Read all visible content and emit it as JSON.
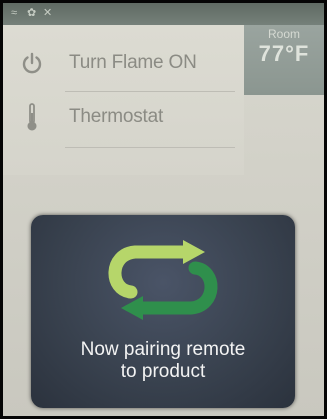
{
  "status_bar": {
    "icons": [
      "wifi-icon",
      "bluetooth-icon",
      "close-icon"
    ]
  },
  "menu": {
    "items": [
      {
        "label": "Turn Flame ON",
        "icon": "power-icon"
      },
      {
        "label": "Thermostat",
        "icon": "thermometer-icon"
      }
    ]
  },
  "room": {
    "label": "Room",
    "temperature": "77°F"
  },
  "overlay": {
    "message_line1": "Now pairing remote",
    "message_line2": "to product",
    "icon": "sync-arrows-icon",
    "colors": {
      "green_light": "#b6d66a",
      "green_dark": "#2f8f4c"
    }
  }
}
